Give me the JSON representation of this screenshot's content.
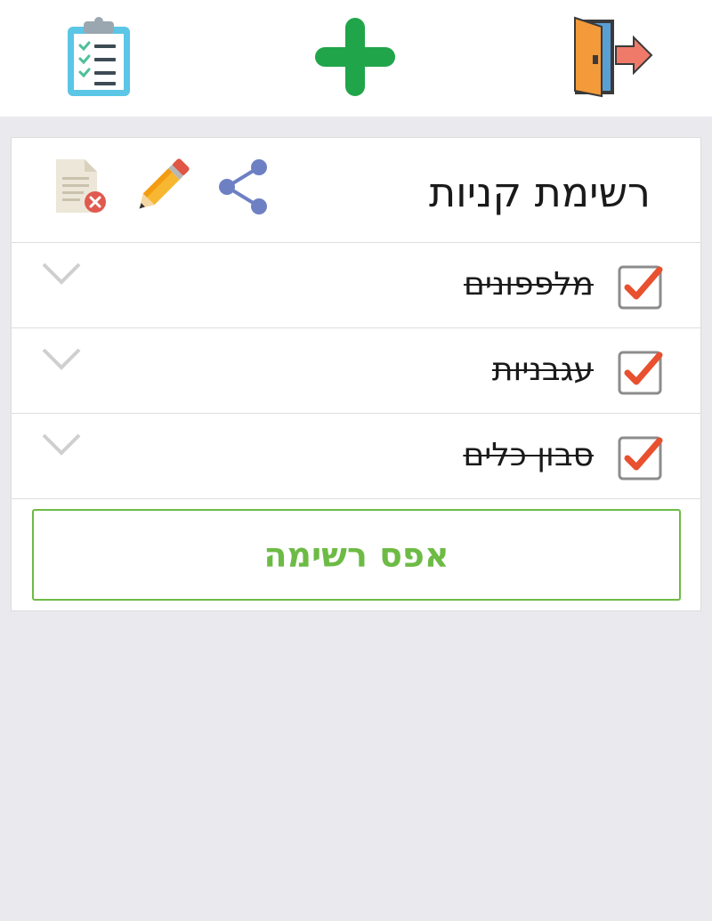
{
  "toolbar": {
    "lists_icon": "clipboard-checklist-icon",
    "add_icon": "plus-icon",
    "exit_icon": "exit-door-icon"
  },
  "list": {
    "title": "רשימת קניות",
    "actions": [
      "share-icon",
      "pencil-icon",
      "delete-document-icon"
    ],
    "items": [
      {
        "label": "מלפפונים",
        "checked": true
      },
      {
        "label": "עגבניות",
        "checked": true
      },
      {
        "label": "סבון כלים",
        "checked": true
      }
    ],
    "reset_label": "אפס רשימה"
  },
  "colors": {
    "accent_green": "#6dbb45",
    "plus_green": "#21a54a",
    "check_red": "#e8502f",
    "share_blue": "#6e80c4"
  }
}
